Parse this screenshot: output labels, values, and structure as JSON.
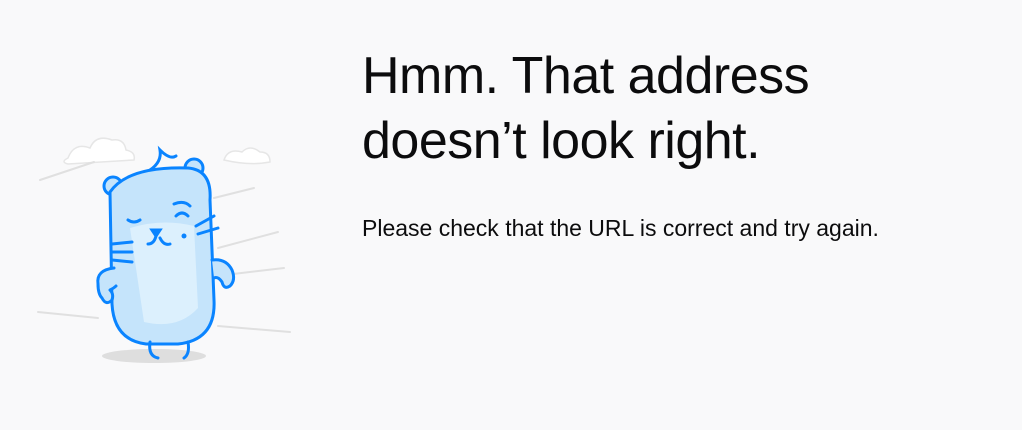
{
  "error_page": {
    "title": "Hmm. That address doesn’t look right.",
    "description": "Please check that the URL is correct and try again.",
    "illustration_icon": "confused-otter-icon",
    "colors": {
      "background": "#f9f9fa",
      "text": "#0c0c0d",
      "accent": "#0a84ff",
      "accent_fill": "#c5e4fb"
    }
  }
}
